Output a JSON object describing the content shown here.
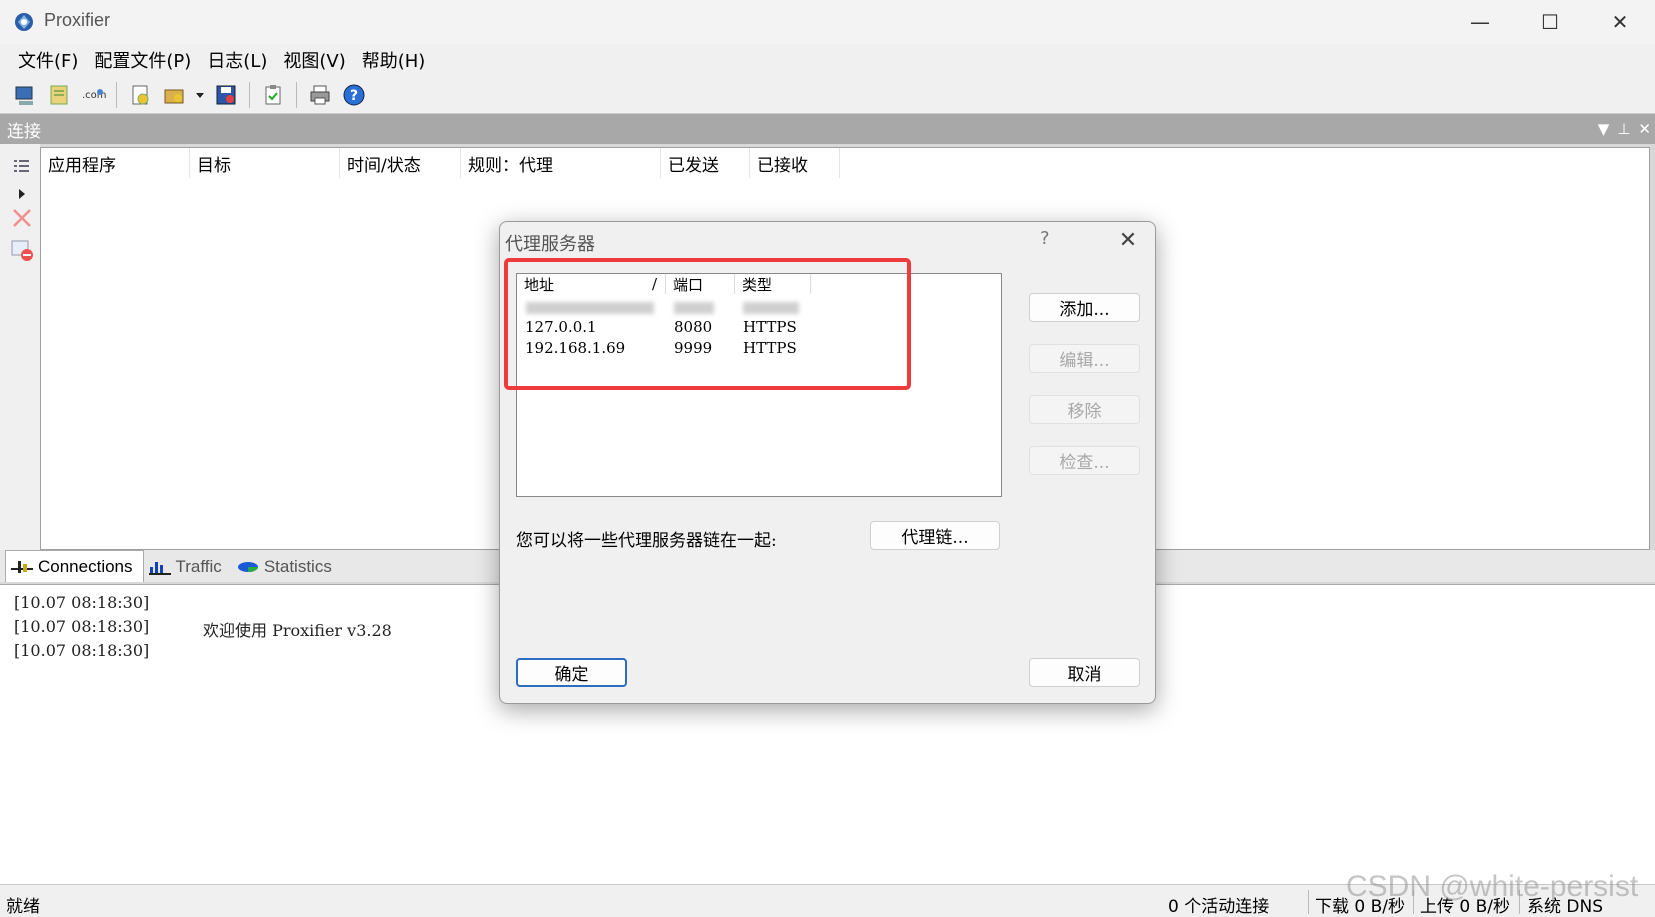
{
  "window": {
    "title": "Proxifier",
    "controls": {
      "minimize": "—",
      "maximize": "☐",
      "close": "✕"
    }
  },
  "menu": [
    "文件(F)",
    "配置文件(P)",
    "日志(L)",
    "视图(V)",
    "帮助(H)"
  ],
  "toolbar_icons": [
    "new-profile-icon",
    "open-profile-icon",
    "dns-icon",
    "proxy-servers-icon",
    "proxy-chains-icon",
    "save-icon",
    "rules-icon",
    "print-icon",
    "help-icon"
  ],
  "panel": {
    "title": "连接",
    "columns": [
      "应用程序",
      "目标",
      "时间/状态",
      "规则：代理",
      "已发送",
      "已接收"
    ]
  },
  "tabs": [
    {
      "label": "Connections",
      "active": true
    },
    {
      "label": "Traffic",
      "active": false
    },
    {
      "label": "Statistics",
      "active": false
    }
  ],
  "log": [
    {
      "time": "[10.07 08:18:30]",
      "message": ""
    },
    {
      "time": "[10.07 08:18:30]",
      "message": "欢迎使用 Proxifier v3.28"
    },
    {
      "time": "[10.07 08:18:30]",
      "message": ""
    }
  ],
  "status": {
    "ready": "就绪",
    "connections": "0 个活动连接",
    "download": "下载 0 B/秒",
    "upload": "上传 0 B/秒",
    "dns": "系统 DNS"
  },
  "watermark": "CSDN @white-persist",
  "dialog": {
    "title": "代理服务器",
    "help": "?",
    "close": "✕",
    "columns": {
      "address": "地址",
      "sort_indicator": "/",
      "port": "端口",
      "type": "类型"
    },
    "servers": [
      {
        "address": "127.0.0.1",
        "port": "8080",
        "type": "HTTPS"
      },
      {
        "address": "192.168.1.69",
        "port": "9999",
        "type": "HTTPS"
      }
    ],
    "buttons": {
      "add": "添加...",
      "edit": "编辑...",
      "remove": "移除",
      "check": "检查...",
      "chain": "代理链...",
      "ok": "确定",
      "cancel": "取消"
    },
    "chain_label": "您可以将一些代理服务器链在一起:",
    "highlight_color": "#ee3b3b"
  }
}
